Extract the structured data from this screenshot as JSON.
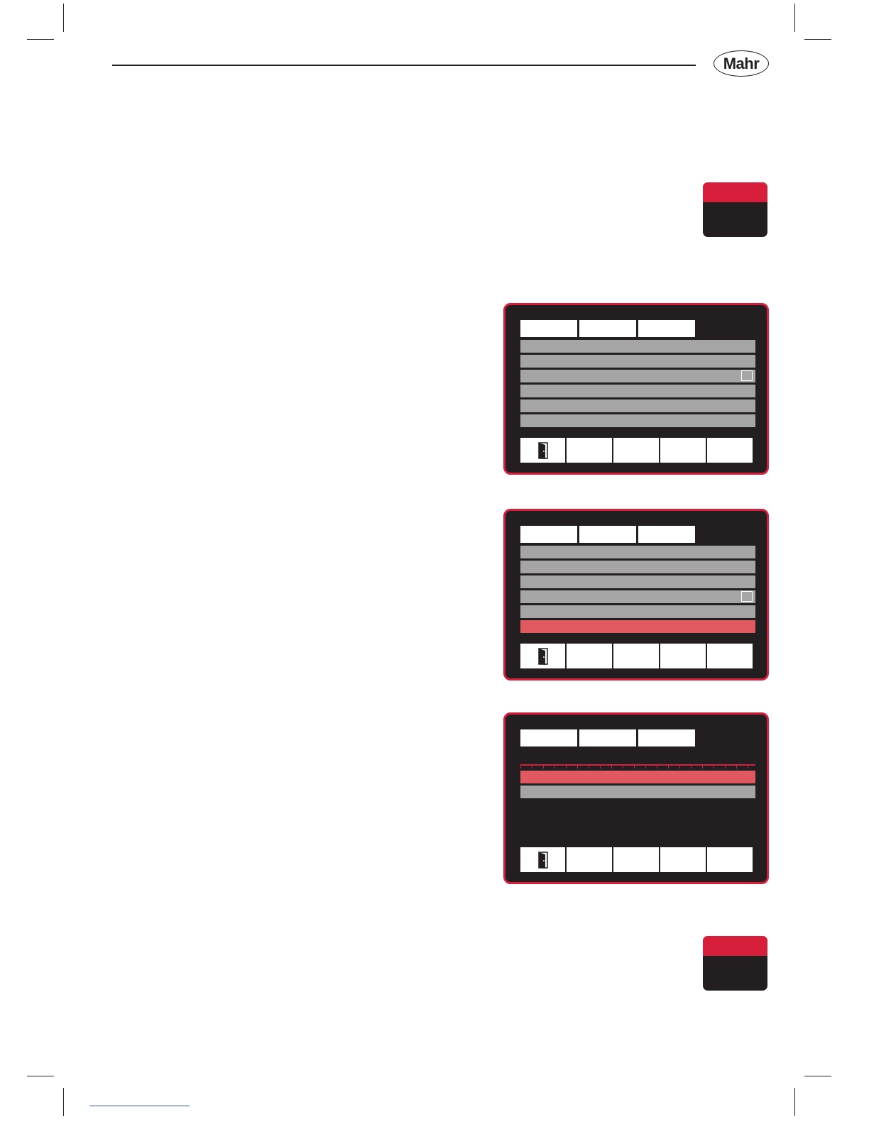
{
  "header": {
    "logo_text": "Mahr"
  },
  "colors": {
    "accent": "#d71e3b",
    "dark": "#231f20",
    "row_gray": "#a6a5a5",
    "row_selected": "#e05860"
  },
  "screens": [
    {
      "tabs": 3,
      "rows": 6,
      "checkbox_row": 3,
      "selected_row": null,
      "softkeys": 5,
      "exit_icon": "exit-door-icon"
    },
    {
      "tabs": 3,
      "rows": 6,
      "checkbox_row": 4,
      "selected_row": 6,
      "softkeys": 5,
      "exit_icon": "exit-door-icon"
    },
    {
      "tabs": 3,
      "rows": 2,
      "checkbox_row": null,
      "selected_row": 1,
      "softkeys": 5,
      "exit_icon": "exit-door-icon"
    }
  ]
}
